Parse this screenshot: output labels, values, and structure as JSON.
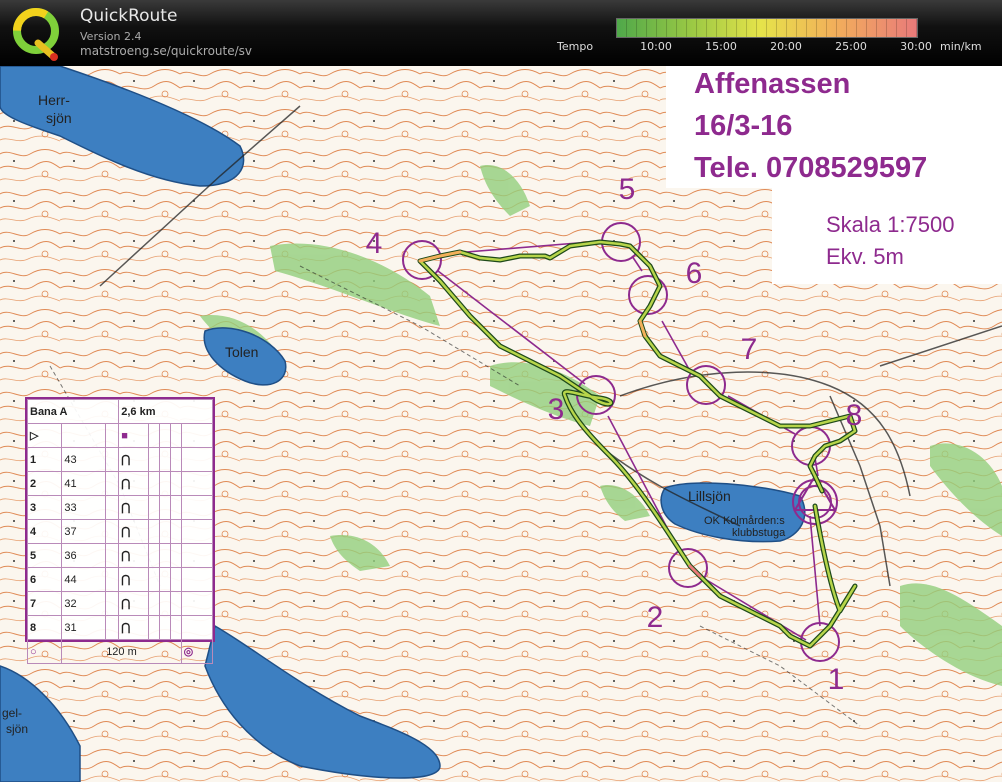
{
  "app": {
    "title": "QuickRoute",
    "version": "Version 2.4",
    "url": "matstroeng.se/quickroute/sv"
  },
  "tempo_scale": {
    "label": "Tempo",
    "ticks": [
      "10:00",
      "15:00",
      "20:00",
      "25:00",
      "30:00"
    ],
    "unit": "min/km",
    "colors": [
      "#4fa84a",
      "#9bc944",
      "#e6e34a",
      "#f2b05a",
      "#e97a7a"
    ]
  },
  "event": {
    "title": "Affenassen",
    "date": "16/3-16",
    "phone": "Tele. 0708529597",
    "scale": "Skala 1:7500",
    "equidistance": "Ekv. 5m"
  },
  "map_labels": {
    "herr": "Herr-",
    "herr2": "sjön",
    "tolen": "Tolen",
    "lillsjon": "Lillsjön",
    "klubb1": "OK Kolmården:s",
    "klubb2": "klubbstuga",
    "gel": "gel-",
    "gel2": "sjön"
  },
  "controls": {
    "c1": "1",
    "c2": "2",
    "c3": "3",
    "c4": "4",
    "c5": "5",
    "c6": "6",
    "c7": "7",
    "c8": "8"
  },
  "description_sheet": {
    "course": "Bana A",
    "length": "2,6 km",
    "footer_distance": "120 m",
    "rows": [
      {
        "num": "1",
        "code": "43"
      },
      {
        "num": "2",
        "code": "41"
      },
      {
        "num": "3",
        "code": "33"
      },
      {
        "num": "4",
        "code": "37"
      },
      {
        "num": "5",
        "code": "36"
      },
      {
        "num": "6",
        "code": "44"
      },
      {
        "num": "7",
        "code": "32"
      },
      {
        "num": "8",
        "code": "31"
      }
    ]
  },
  "colors": {
    "course": "#8e2a8e",
    "water": "#3d7fc1",
    "contour": "#d9723a",
    "vegetation": "#93cf7d"
  }
}
